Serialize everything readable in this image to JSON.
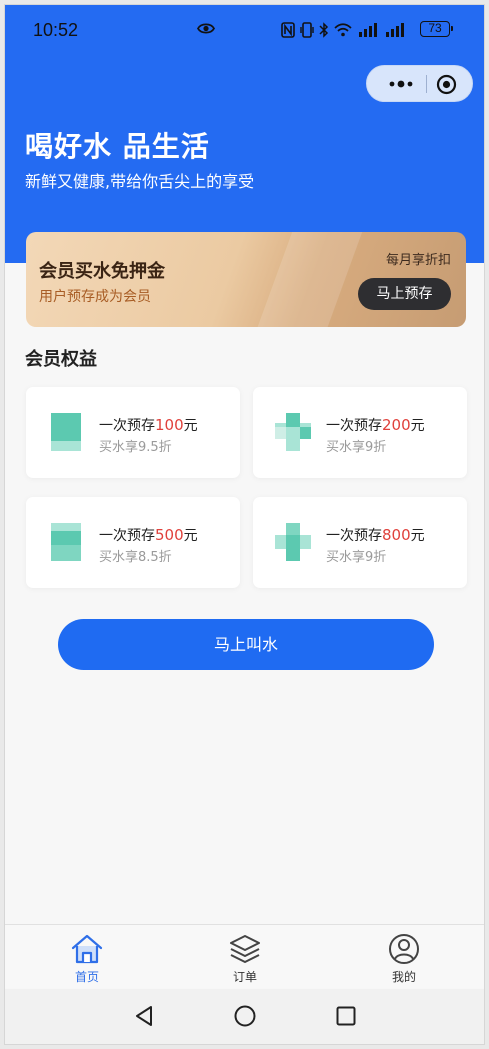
{
  "status_bar": {
    "time": "10:52",
    "battery": "73"
  },
  "hero": {
    "title": "喝好水 品生活",
    "subtitle": "新鲜又健康,带给你舌尖上的享受",
    "bg_color": "#246bf2"
  },
  "banner": {
    "title": "会员买水免押金",
    "subtitle": "用户预存成为会员",
    "note": "每月享折扣",
    "button_label": "马上预存"
  },
  "benefits": {
    "title": "会员权益",
    "items": [
      {
        "prefix": "一次预存",
        "amount": "100",
        "unit": "元",
        "discount": "买水享9.5折"
      },
      {
        "prefix": "一次预存",
        "amount": "200",
        "unit": "元",
        "discount": "买水享9折"
      },
      {
        "prefix": "一次预存",
        "amount": "500",
        "unit": "元",
        "discount": "买水享8.5折"
      },
      {
        "prefix": "一次预存",
        "amount": "800",
        "unit": "元",
        "discount": "买水享9折"
      }
    ],
    "amount_color": "#e0413c"
  },
  "main_button": {
    "label": "马上叫水",
    "color": "#1f6bf2"
  },
  "tabbar": {
    "items": [
      {
        "label": "首页",
        "icon": "home-icon",
        "active": true
      },
      {
        "label": "订单",
        "icon": "layers-icon",
        "active": false
      },
      {
        "label": "我的",
        "icon": "user-icon",
        "active": false
      }
    ],
    "active_color": "#2f6fe8"
  },
  "system_nav": {
    "icons": [
      "back-icon",
      "home-circle-icon",
      "recents-icon"
    ]
  }
}
